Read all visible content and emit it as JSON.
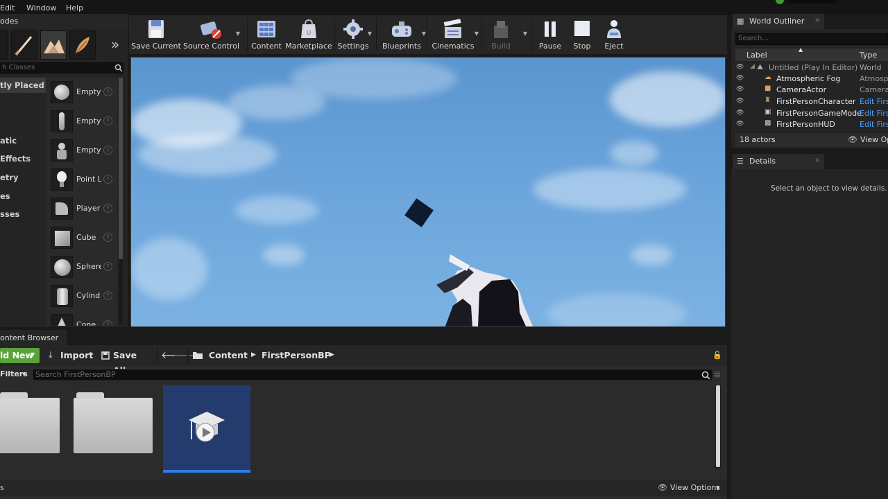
{
  "menu": {
    "items": [
      "Edit",
      "Window",
      "Help"
    ]
  },
  "modes": {
    "tab_label": "odes",
    "search_placeholder": "h Classes",
    "categories": [
      {
        "label": "tly Placed",
        "selected": true
      },
      {
        "label": "atic",
        "selected": false
      },
      {
        "label": "Effects",
        "selected": false
      },
      {
        "label": "etry",
        "selected": false
      },
      {
        "label": "es",
        "selected": false
      },
      {
        "label": "sses",
        "selected": false
      }
    ],
    "items": [
      {
        "label": "Empty",
        "icon": "sphere-icon"
      },
      {
        "label": "Empty",
        "icon": "character-icon"
      },
      {
        "label": "Empty",
        "icon": "pawn-icon"
      },
      {
        "label": "Point L",
        "icon": "light-bulb-icon"
      },
      {
        "label": "Player",
        "icon": "player-start-icon"
      },
      {
        "label": "Cube",
        "icon": "cube-icon"
      },
      {
        "label": "Sphere",
        "icon": "sphere-icon"
      },
      {
        "label": "Cylind",
        "icon": "cylinder-icon"
      },
      {
        "label": "Cone",
        "icon": "cone-icon"
      }
    ],
    "help_glyph": "?"
  },
  "toolbar": {
    "buttons": [
      {
        "label": "Save Current",
        "icon": "save-icon",
        "dim": false
      },
      {
        "label": "Source Control",
        "icon": "source-control-icon",
        "dim": false
      },
      {
        "label": "Content",
        "icon": "content-icon",
        "dim": false
      },
      {
        "label": "Marketplace",
        "icon": "marketplace-icon",
        "dim": false
      },
      {
        "label": "Settings",
        "icon": "settings-icon",
        "dim": false
      },
      {
        "label": "Blueprints",
        "icon": "blueprints-icon",
        "dim": false
      },
      {
        "label": "Cinematics",
        "icon": "cinematics-icon",
        "dim": false
      },
      {
        "label": "Build",
        "icon": "build-icon",
        "dim": true
      },
      {
        "label": "Pause",
        "icon": "pause-icon",
        "dim": false
      },
      {
        "label": "Stop",
        "icon": "stop-icon",
        "dim": false
      },
      {
        "label": "Eject",
        "icon": "eject-icon",
        "dim": false
      }
    ]
  },
  "content_browser": {
    "tab_label": "ontent Browser",
    "add_new": "ld New",
    "import": "Import",
    "save_all": "Save All",
    "path": [
      "Content",
      "FirstPersonBP"
    ],
    "filters": "Filters",
    "search_placeholder": "Search FirstPersonBP",
    "view_options": "View Options",
    "footer_left": "s"
  },
  "world_outliner": {
    "tab_label": "World Outliner",
    "search_placeholder": "Search...",
    "col_label": "Label",
    "col_type": "Type",
    "rows": [
      {
        "name": "Untitled (Play In Editor)",
        "type": "World",
        "link": false,
        "indent": 1
      },
      {
        "name": "Atmospheric Fog",
        "type": "Atmosph",
        "link": false,
        "indent": 2
      },
      {
        "name": "CameraActor",
        "type": "CameraA",
        "link": false,
        "indent": 2
      },
      {
        "name": "FirstPersonCharacter",
        "type": "Edit Firs",
        "link": true,
        "indent": 2
      },
      {
        "name": "FirstPersonGameMode",
        "type": "Edit Firs",
        "link": true,
        "indent": 2
      },
      {
        "name": "FirstPersonHUD",
        "type": "Edit Firs",
        "link": true,
        "indent": 2
      }
    ],
    "actor_count": "18 actors",
    "view_options": "View Op"
  },
  "details": {
    "tab_label": "Details",
    "empty_message": "Select an object to view details."
  },
  "colors": {
    "accent": "#2f7fe8",
    "add_new": "#5aa33a",
    "link": "#4fa3ff"
  }
}
